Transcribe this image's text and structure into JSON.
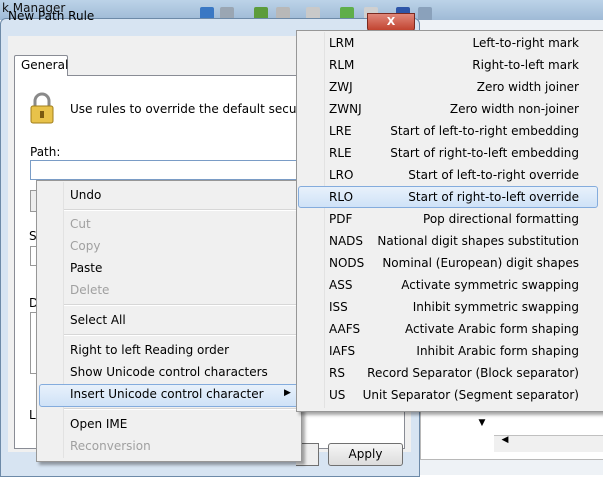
{
  "background_window": {
    "title": "k Manager"
  },
  "dialog": {
    "title": "New Path Rule",
    "tab": "General",
    "description": "Use rules to override the default security level.",
    "path_label": "Path:",
    "path_value": "‭‮",
    "s_label": "S",
    "d_label": "D",
    "l_label": "L",
    "apply_label": "Apply",
    "close_glyph": "X"
  },
  "context_menu": {
    "items": [
      {
        "label": "Undo",
        "enabled": true
      },
      {
        "label": "Cut",
        "enabled": false
      },
      {
        "label": "Copy",
        "enabled": false
      },
      {
        "label": "Paste",
        "enabled": true
      },
      {
        "label": "Delete",
        "enabled": false
      },
      {
        "label": "Select All",
        "enabled": true
      },
      {
        "label": "Right to left Reading order",
        "enabled": true
      },
      {
        "label": "Show Unicode control characters",
        "enabled": true
      },
      {
        "label": "Insert Unicode control character",
        "enabled": true,
        "submenu": true
      },
      {
        "label": "Open IME",
        "enabled": true
      },
      {
        "label": "Reconversion",
        "enabled": false
      }
    ]
  },
  "submenu": {
    "items": [
      {
        "code": "LRM",
        "desc": "Left-to-right mark"
      },
      {
        "code": "RLM",
        "desc": "Right-to-left mark"
      },
      {
        "code": "ZWJ",
        "desc": "Zero width joiner"
      },
      {
        "code": "ZWNJ",
        "desc": "Zero width non-joiner"
      },
      {
        "code": "LRE",
        "desc": "Start of left-to-right embedding"
      },
      {
        "code": "RLE",
        "desc": "Start of right-to-left embedding"
      },
      {
        "code": "LRO",
        "desc": "Start of left-to-right override"
      },
      {
        "code": "RLO",
        "desc": "Start of right-to-left override"
      },
      {
        "code": "PDF",
        "desc": "Pop directional formatting"
      },
      {
        "code": "NADS",
        "desc": "National digit shapes substitution"
      },
      {
        "code": "NODS",
        "desc": "Nominal (European) digit shapes"
      },
      {
        "code": "ASS",
        "desc": "Activate symmetric swapping"
      },
      {
        "code": "ISS",
        "desc": "Inhibit symmetric swapping"
      },
      {
        "code": "AAFS",
        "desc": "Activate Arabic form shaping"
      },
      {
        "code": "IAFS",
        "desc": "Inhibit Arabic form shaping"
      },
      {
        "code": "RS",
        "desc": "Record Separator (Block separator)"
      },
      {
        "code": "US",
        "desc": "Unit Separator (Segment separator)"
      }
    ]
  },
  "colors": {
    "highlight_border": "#84acdd",
    "title_bar": "#bcd3e8",
    "close_button": "#c0402c"
  }
}
